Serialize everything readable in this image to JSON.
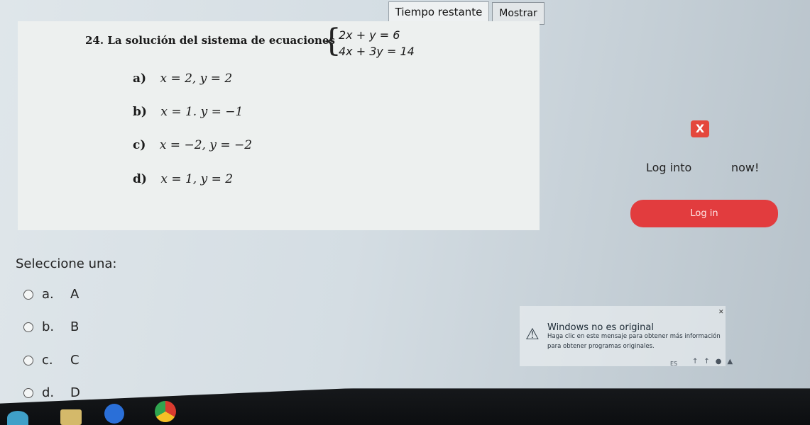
{
  "header": {
    "timer_label": "Tiempo restante",
    "show_button": "Mostrar"
  },
  "question": {
    "title": "24. La solución del sistema de ecuaciones",
    "equations": [
      "2x + y = 6",
      "4x + 3y = 14"
    ],
    "options": [
      {
        "letter": "a)",
        "text": "x = 2, y = 2"
      },
      {
        "letter": "b)",
        "text": "x = 1. y = −1"
      },
      {
        "letter": "c)",
        "text": "x = −2, y = −2"
      },
      {
        "letter": "d)",
        "text": "x = 1, y = 2"
      }
    ]
  },
  "promo": {
    "logo": "X",
    "login_text": "Log into",
    "now_text": "now!",
    "login_button": "Log in"
  },
  "answers": {
    "prompt": "Seleccione una:",
    "choices": [
      {
        "letter": "a.",
        "label": "A"
      },
      {
        "letter": "b.",
        "label": "B"
      },
      {
        "letter": "c.",
        "label": "C"
      },
      {
        "letter": "d.",
        "label": "D"
      }
    ]
  },
  "windows_notice": {
    "title": "Windows no es original",
    "line1": "Haga clic en este mensaje para obtener más información",
    "line2": "para obtener programas originales."
  },
  "taskbar": {
    "language": "ES",
    "icons": [
      "edge-icon",
      "file-explorer-icon",
      "media-player-icon",
      "chrome-icon"
    ]
  },
  "colors": {
    "accent_red": "#e23c3e",
    "panel": "#edf0ef"
  }
}
